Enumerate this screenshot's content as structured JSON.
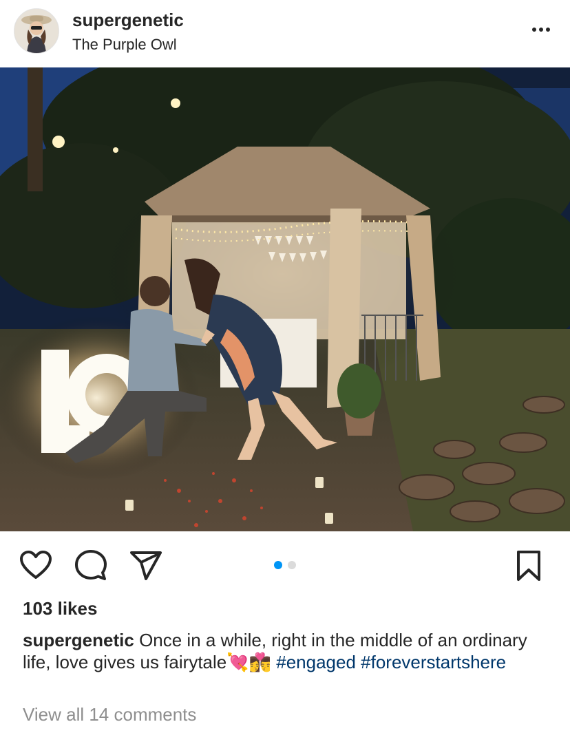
{
  "post": {
    "username": "supergenetic",
    "location": "The Purple Owl",
    "more_icon": "more-horizontal-icon"
  },
  "photo": {
    "letters": "LO"
  },
  "actions": {
    "like_icon": "heart-outline-icon",
    "comment_icon": "comment-bubble-icon",
    "share_icon": "paper-plane-icon",
    "save_icon": "bookmark-outline-icon",
    "carousel_count": 2,
    "carousel_active": 0,
    "active_dot_color": "#0095f6",
    "inactive_dot_color": "#dbdbdb"
  },
  "likes": "103 likes",
  "caption": {
    "username": "supergenetic",
    "text": "Once in a while, right in the middle of an ordinary life, love gives us fairytale",
    "emojis": "💘👩‍❤️‍💋‍👨",
    "hashtag1": "#engaged",
    "hashtag2": "#foreverstartshere"
  },
  "comments_link": "View all 14 comments",
  "colors": {
    "text": "#262626",
    "hashtag": "#00376b",
    "muted": "#8e8e8e"
  }
}
